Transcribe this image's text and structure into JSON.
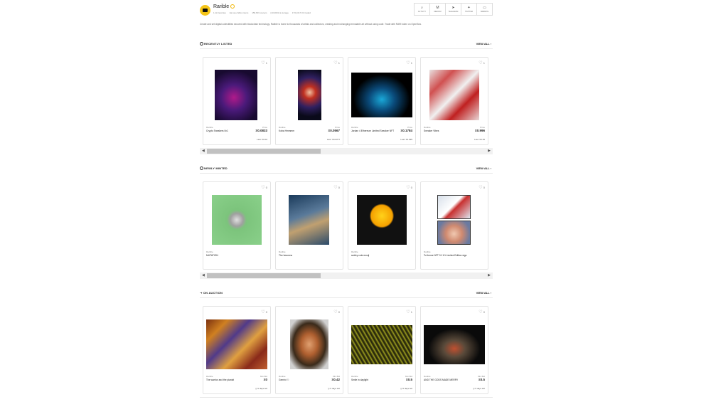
{
  "profile": {
    "name": "Rarible",
    "stats": [
      "1.1k favorites",
      "Est.one billion items",
      "156,819 owners",
      "(10,0001 & storage",
      "1731,017.01 traded"
    ]
  },
  "links": [
    {
      "icon": "activity-icon",
      "glyph": "⌕",
      "label": "ACTIVITY"
    },
    {
      "icon": "medium-icon",
      "glyph": "M",
      "label": "MEDIUM"
    },
    {
      "icon": "telegram-icon",
      "glyph": "➤",
      "label": "TELEGRAM"
    },
    {
      "icon": "twitter-icon",
      "glyph": "✦",
      "label": "TWITTER"
    },
    {
      "icon": "website-icon",
      "glyph": "▭",
      "label": "WEBSITE"
    }
  ],
  "description": "Create and sell digital collectibles secured with blockchain technology. Rarible is home to thousands of artists and collectors, creating and exchanging immutable art without using code. Trade with RARI token on OpenSea.",
  "sections": {
    "recent": {
      "title": "RECENTLY LISTED",
      "view_all": "VIEW ALL",
      "cards": [
        {
          "likes": "1",
          "brand": "Rarible",
          "name": "Crypto Sneakers 0x1",
          "price_label": "Price",
          "price": "Ξ0.0833",
          "last": "Last: ≡0.02"
        },
        {
          "likes": "1",
          "brand": "Rarible",
          "name": "Koba Hmmmm",
          "price_label": "Price",
          "price": "Ξ0.0567",
          "last": "Last: ≡0.0377"
        },
        {
          "likes": "1",
          "brand": "Rarible",
          "name": "Jordan 4 Ethereum Limited Sneaker NFT",
          "price_label": "Price",
          "price": "Ξ0.1784",
          "last": "Last: ≡0.095"
        },
        {
          "likes": "1",
          "brand": "Rarible",
          "name": "Sneaker Vibes",
          "price_label": "Price",
          "price": "Ξ0.996",
          "last": "Last: ≡0.35"
        }
      ]
    },
    "minted": {
      "title": "NEWLY MINTED",
      "view_all": "VIEW ALL",
      "cards": [
        {
          "likes": "0",
          "brand": "Rarible",
          "name": "MUTATION"
        },
        {
          "likes": "0",
          "brand": "Rarible",
          "name": "The heavens"
        },
        {
          "likes": "0",
          "brand": "Rarible",
          "name": "smiley cute emoji"
        },
        {
          "likes": "0",
          "brand": "Rarible",
          "name": "To theme NFT 01 1/1 Limited Edition sign"
        }
      ]
    },
    "auction": {
      "title": "ON AUCTION",
      "view_all": "VIEW ALL",
      "cards": [
        {
          "likes": "0",
          "brand": "Rarible",
          "name": "The warrior and the pianist",
          "price_label": "Min Bid",
          "price": "Ξ0",
          "time": "5 days left"
        },
        {
          "likes": "0",
          "brand": "Rarible",
          "name": "Gemini ☉",
          "price_label": "Min Bid",
          "price": "Ξ0.42",
          "time": "5 days left"
        },
        {
          "likes": "1",
          "brand": "Rarible",
          "name": "Smile in daylight",
          "price_label": "Min Bid",
          "price": "Ξ0.5",
          "time": "5 days left"
        },
        {
          "likes": "0",
          "brand": "Rarible",
          "name": "AND THE GODS MADE MERRY",
          "price_label": "Min Bid",
          "price": "Ξ0.5",
          "time": "5 days left"
        }
      ]
    }
  }
}
